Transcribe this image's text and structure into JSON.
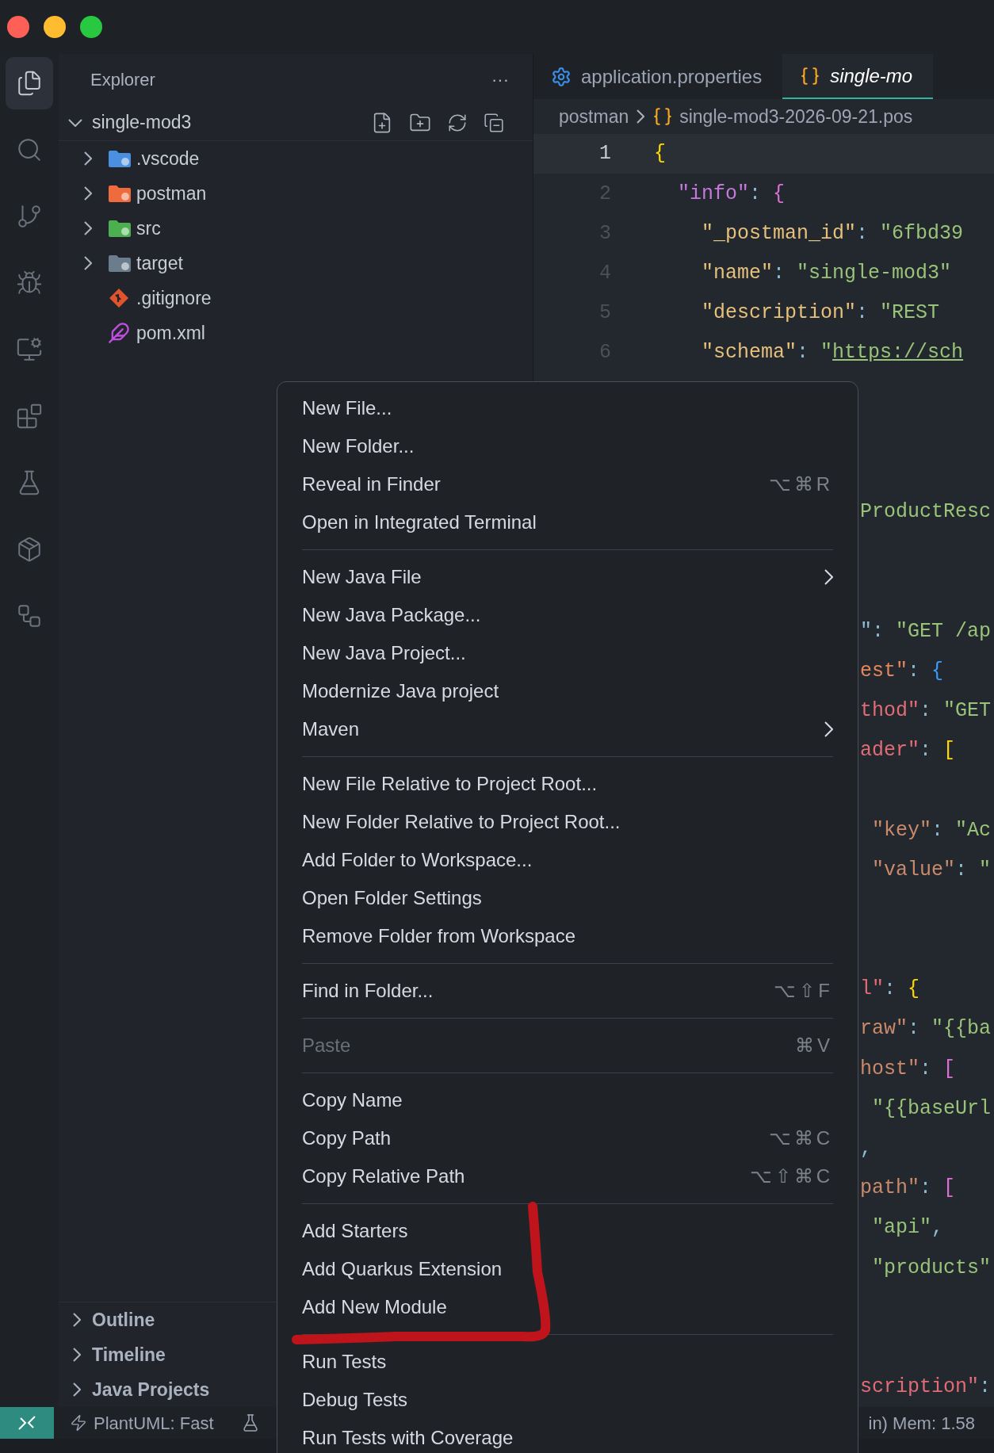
{
  "activity_bar": [
    {
      "selected": true
    },
    {
      "selected": false
    },
    {
      "selected": false
    },
    {
      "selected": false
    },
    {
      "selected": false
    },
    {
      "selected": false
    },
    {
      "selected": false
    },
    {
      "selected": false
    },
    {
      "selected": false
    }
  ],
  "sidebar": {
    "title": "Explorer",
    "more": "···",
    "root": {
      "label": "single-mod3",
      "expanded": true
    },
    "items": [
      {
        "label": ".vscode",
        "kind": "folder",
        "expanded": false,
        "color": "#4a8fe0"
      },
      {
        "label": "postman",
        "kind": "folder",
        "expanded": false,
        "color": "#ef6a3d"
      },
      {
        "label": "src",
        "kind": "folder",
        "expanded": false,
        "color": "#4caf50"
      },
      {
        "label": "target",
        "kind": "folder",
        "expanded": false,
        "color": "#6b7c8c"
      },
      {
        "label": ".gitignore",
        "kind": "git-file"
      },
      {
        "label": "pom.xml",
        "kind": "xml-file"
      }
    ],
    "sections": [
      {
        "label": "Outline",
        "expanded": false
      },
      {
        "label": "Timeline",
        "expanded": false
      },
      {
        "label": "Java Projects",
        "expanded": false
      }
    ]
  },
  "tabs": [
    {
      "label": "application.properties",
      "kind": "properties",
      "selected": false
    },
    {
      "label": "single-mo",
      "kind": "json",
      "selected": true
    }
  ],
  "breadcrumb": [
    {
      "label": "postman",
      "kind": "folder"
    },
    {
      "label": "single-mod3-2026-09-21.pos",
      "kind": "json"
    }
  ],
  "editor": {
    "lines": [
      {
        "kind": "full",
        "number": "1",
        "current": true,
        "tokens": [
          {
            "text": "{",
            "color": "#ffd700"
          }
        ]
      },
      {
        "kind": "full",
        "number": "2",
        "current": false,
        "tokens": [
          {
            "text": "  \"info\"",
            "color": "#c678dd"
          },
          {
            "text": ": ",
            "color": "#8fbcd4"
          },
          {
            "text": "{",
            "color": "#da70d6"
          }
        ]
      },
      {
        "kind": "full",
        "number": "3",
        "current": false,
        "tokens": [
          {
            "text": "    \"_postman_id\"",
            "color": "#e5c07b"
          },
          {
            "text": ": ",
            "color": "#8fbcd4"
          },
          {
            "text": "\"6fbd39",
            "color": "#98c379"
          }
        ]
      },
      {
        "kind": "full",
        "number": "4",
        "current": false,
        "tokens": [
          {
            "text": "    \"name\"",
            "color": "#e5c07b"
          },
          {
            "text": ": ",
            "color": "#8fbcd4"
          },
          {
            "text": "\"single-mod3\"",
            "color": "#98c379"
          }
        ]
      },
      {
        "kind": "full",
        "number": "5",
        "current": false,
        "tokens": [
          {
            "text": "    \"description\"",
            "color": "#e5c07b"
          },
          {
            "text": ": ",
            "color": "#8fbcd4"
          },
          {
            "text": "\"REST",
            "color": "#98c379"
          }
        ]
      },
      {
        "kind": "full",
        "number": "6",
        "current": false,
        "tokens": [
          {
            "text": "    \"schema\"",
            "color": "#e5c07b"
          },
          {
            "text": ": ",
            "color": "#8fbcd4"
          },
          {
            "text": "\"",
            "color": "#98c379"
          },
          {
            "text": "https://sch",
            "color": "#98c379",
            "link": true
          }
        ]
      },
      {
        "kind": "hidden"
      },
      {
        "kind": "hidden"
      },
      {
        "kind": "hidden"
      },
      {
        "kind": "fragment",
        "tokens": [
          {
            "text": "ProductResc",
            "color": "#98c379"
          }
        ]
      },
      {
        "kind": "hidden"
      },
      {
        "kind": "hidden"
      },
      {
        "kind": "fragment",
        "tokens": [
          {
            "text": "\": ",
            "color": "#8fbcd4"
          },
          {
            "text": "\"GET /ap",
            "color": "#98c379"
          }
        ]
      },
      {
        "kind": "fragment",
        "tokens": [
          {
            "text": "est\"",
            "color": "#e5865b"
          },
          {
            "text": ": ",
            "color": "#8fbcd4"
          },
          {
            "text": "{",
            "color": "#3b9cff"
          }
        ]
      },
      {
        "kind": "fragment",
        "tokens": [
          {
            "text": "thod\"",
            "color": "#e06c75"
          },
          {
            "text": ": ",
            "color": "#8fbcd4"
          },
          {
            "text": "\"GET",
            "color": "#98c379"
          }
        ]
      },
      {
        "kind": "fragment",
        "tokens": [
          {
            "text": "ader\"",
            "color": "#e06c75"
          },
          {
            "text": ": ",
            "color": "#8fbcd4"
          },
          {
            "text": "[",
            "color": "#ffd700"
          }
        ]
      },
      {
        "kind": "hidden"
      },
      {
        "kind": "fragment",
        "tokens": [
          {
            "text": " \"key\"",
            "color": "#c98a6b"
          },
          {
            "text": ": ",
            "color": "#8fbcd4"
          },
          {
            "text": "\"Ac",
            "color": "#98c379"
          }
        ]
      },
      {
        "kind": "fragment",
        "tokens": [
          {
            "text": " \"value\"",
            "color": "#c98a6b"
          },
          {
            "text": ": ",
            "color": "#8fbcd4"
          },
          {
            "text": "\"",
            "color": "#98c379"
          }
        ]
      },
      {
        "kind": "hidden"
      },
      {
        "kind": "hidden"
      },
      {
        "kind": "fragment",
        "tokens": [
          {
            "text": "l\"",
            "color": "#e06c75"
          },
          {
            "text": ": ",
            "color": "#8fbcd4"
          },
          {
            "text": "{",
            "color": "#ffd700"
          }
        ]
      },
      {
        "kind": "fragment",
        "tokens": [
          {
            "text": "raw\"",
            "color": "#c98a6b"
          },
          {
            "text": ": ",
            "color": "#8fbcd4"
          },
          {
            "text": "\"{{ba",
            "color": "#98c379"
          }
        ]
      },
      {
        "kind": "fragment",
        "tokens": [
          {
            "text": "host\"",
            "color": "#c98a6b"
          },
          {
            "text": ": ",
            "color": "#8fbcd4"
          },
          {
            "text": "[",
            "color": "#da70d6"
          }
        ]
      },
      {
        "kind": "fragment",
        "tokens": [
          {
            "text": " \"{{baseUrl",
            "color": "#98c379"
          }
        ]
      },
      {
        "kind": "fragment",
        "tokens": [
          {
            "text": ",",
            "color": "#8fbcd4"
          }
        ]
      },
      {
        "kind": "fragment",
        "tokens": [
          {
            "text": "path\"",
            "color": "#c98a6b"
          },
          {
            "text": ": ",
            "color": "#8fbcd4"
          },
          {
            "text": "[",
            "color": "#da70d6"
          }
        ]
      },
      {
        "kind": "fragment",
        "tokens": [
          {
            "text": " \"api\"",
            "color": "#98c379"
          },
          {
            "text": ",",
            "color": "#8fbcd4"
          }
        ]
      },
      {
        "kind": "fragment",
        "tokens": [
          {
            "text": " \"products\"",
            "color": "#98c379"
          }
        ]
      },
      {
        "kind": "hidden"
      },
      {
        "kind": "hidden"
      },
      {
        "kind": "fragment",
        "tokens": [
          {
            "text": "scription\"",
            "color": "#e06c75"
          },
          {
            "text": ":",
            "color": "#8fbcd4"
          }
        ]
      }
    ]
  },
  "context_menu": {
    "groups": [
      [
        {
          "label": "New File...",
          "disabled": false,
          "submenu": false
        },
        {
          "label": "New Folder...",
          "disabled": false,
          "submenu": false
        },
        {
          "label": "Reveal in Finder",
          "shortcut": "⌥⌘R",
          "disabled": false,
          "submenu": false
        },
        {
          "label": "Open in Integrated Terminal",
          "disabled": false,
          "submenu": false
        }
      ],
      [
        {
          "label": "New Java File",
          "disabled": false,
          "submenu": true
        },
        {
          "label": "New Java Package...",
          "disabled": false,
          "submenu": false
        },
        {
          "label": "New Java Project...",
          "disabled": false,
          "submenu": false
        },
        {
          "label": "Modernize Java project",
          "disabled": false,
          "submenu": false
        },
        {
          "label": "Maven",
          "disabled": false,
          "submenu": true
        }
      ],
      [
        {
          "label": "New File Relative to Project Root...",
          "disabled": false,
          "submenu": false
        },
        {
          "label": "New Folder Relative to Project Root...",
          "disabled": false,
          "submenu": false
        },
        {
          "label": "Add Folder to Workspace...",
          "disabled": false,
          "submenu": false
        },
        {
          "label": "Open Folder Settings",
          "disabled": false,
          "submenu": false
        },
        {
          "label": "Remove Folder from Workspace",
          "disabled": false,
          "submenu": false
        }
      ],
      [
        {
          "label": "Find in Folder...",
          "shortcut": "⌥⇧F",
          "disabled": false,
          "submenu": false
        }
      ],
      [
        {
          "label": "Paste",
          "shortcut": "⌘V",
          "disabled": true,
          "submenu": false
        }
      ],
      [
        {
          "label": "Copy Name",
          "disabled": false,
          "submenu": false
        },
        {
          "label": "Copy Path",
          "shortcut": "⌥⌘C",
          "disabled": false,
          "submenu": false
        },
        {
          "label": "Copy Relative Path",
          "shortcut": "⌥⇧⌘C",
          "disabled": false,
          "submenu": false
        }
      ],
      [
        {
          "label": "Add Starters",
          "disabled": false,
          "submenu": false
        },
        {
          "label": "Add Quarkus Extension",
          "disabled": false,
          "submenu": false
        },
        {
          "label": "Add New Module",
          "disabled": false,
          "submenu": false
        }
      ],
      [
        {
          "label": "Run Tests",
          "disabled": false,
          "submenu": false
        },
        {
          "label": "Debug Tests",
          "disabled": false,
          "submenu": false
        },
        {
          "label": "Run Tests with Coverage",
          "disabled": false,
          "submenu": false
        }
      ]
    ]
  },
  "status_bar": {
    "plantuml": "PlantUML: Fast",
    "memory": "in) Mem: 1.58"
  }
}
